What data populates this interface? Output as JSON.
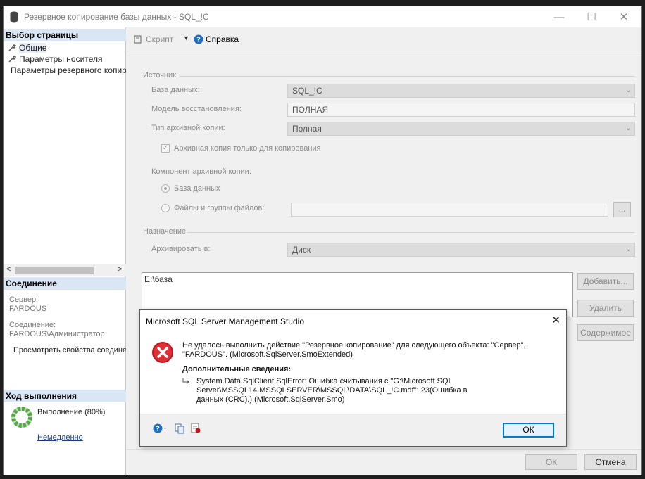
{
  "window": {
    "title": "Резервное копирование базы данных - SQL_!C"
  },
  "left": {
    "pages_header": "Выбор страницы",
    "pages": [
      "Общие",
      "Параметры носителя",
      "Параметры резервного копирования"
    ],
    "connection_header": "Соединение",
    "server_label": "Сервер:",
    "server_value": "FARDOUS",
    "connection_label": "Соединение:",
    "connection_value": "FARDOUS\\Администратор",
    "view_props": "Просмотреть свойства соединения",
    "progress_header": "Ход выполнения",
    "progress_text": "Выполнение (80%)",
    "progress_value": 0.8,
    "stop_link": "Немедленно"
  },
  "toolbar": {
    "script": "Скрипт",
    "help": "Справка"
  },
  "source": {
    "group": "Источник",
    "db_label": "База данных:",
    "db_value": "SQL_!C",
    "recovery_label": "Модель восстановления:",
    "recovery_value": "ПОЛНАЯ",
    "type_label": "Тип архивной копии:",
    "type_value": "Полная",
    "copy_only": "Архивная копия только для копирования",
    "component_label": "Компонент архивной копии:",
    "radio_db": "База данных",
    "radio_files": "Файлы и группы файлов:",
    "browse": "..."
  },
  "destination": {
    "group": "Назначение",
    "backup_to_label": "Архивировать в:",
    "backup_to_value": "Диск",
    "paths": [
      "E:\\база"
    ],
    "add": "Добавить...",
    "remove": "Удалить",
    "contents": "Содержимое"
  },
  "footer": {
    "ok": "ОК",
    "cancel": "Отмена"
  },
  "dialog": {
    "title": "Microsoft SQL Server Management Studio",
    "message": "Не удалось выполнить действие \"Резервное копирование\" для следующего объекта: \"Сервер\", \"FARDOUS\".  (Microsoft.SqlServer.SmoExtended)",
    "additional": "Дополнительные сведения:",
    "detail": "System.Data.SqlClient.SqlError: Ошибка считывания с \"G:\\Microsoft SQL Server\\MSSQL14.MSSQLSERVER\\MSSQL\\DATA\\SQL_!C.mdf\": 23(Ошибка в данных (CRC).) (Microsoft.SqlServer.Smo)",
    "ok": "ОК"
  }
}
